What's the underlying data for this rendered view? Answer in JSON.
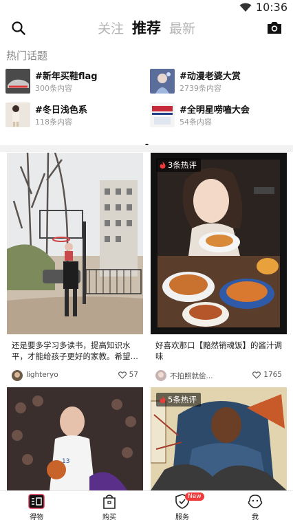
{
  "status_bar": {
    "time": "10:36",
    "wifi_icon": "wifi-icon"
  },
  "header": {
    "tabs": [
      {
        "label": "关注",
        "active": false
      },
      {
        "label": "推荐",
        "active": true
      },
      {
        "label": "最新",
        "active": false
      }
    ],
    "search_icon": "search-icon",
    "camera_icon": "camera-icon"
  },
  "hot_topics": {
    "title": "热门话题",
    "items": [
      {
        "name": "#新年买鞋flag",
        "count": "300条内容"
      },
      {
        "name": "#动漫老婆大赏",
        "count": "2739条内容"
      },
      {
        "name": "#冬日浅色系",
        "count": "118条内容"
      },
      {
        "name": "#全明星唠嗑大会",
        "count": "54条内容"
      }
    ]
  },
  "feed": [
    {
      "desc": "还是要多学习多读书，提高知识水平，才能给孩子更好的家教。希望…",
      "author": "lighteryo",
      "likes": "57",
      "badge": ""
    },
    {
      "desc": "好喜欢那口【黯然销魂饭】的酱汁调味",
      "author": "不拍照就侩...",
      "likes": "1765",
      "badge": "3条热评"
    },
    {
      "desc": "",
      "author": "",
      "likes": "",
      "badge": ""
    },
    {
      "desc": "",
      "author": "",
      "likes": "",
      "badge": "5条热评"
    }
  ],
  "bottom_nav": {
    "items": [
      {
        "label": "得物"
      },
      {
        "label": "购买"
      },
      {
        "label": "服务",
        "tag": "New"
      },
      {
        "label": "我"
      }
    ]
  },
  "colors": {
    "accent": "#ee3a3a",
    "active_text": "#111111",
    "inactive_tab": "#b5b5b5"
  }
}
